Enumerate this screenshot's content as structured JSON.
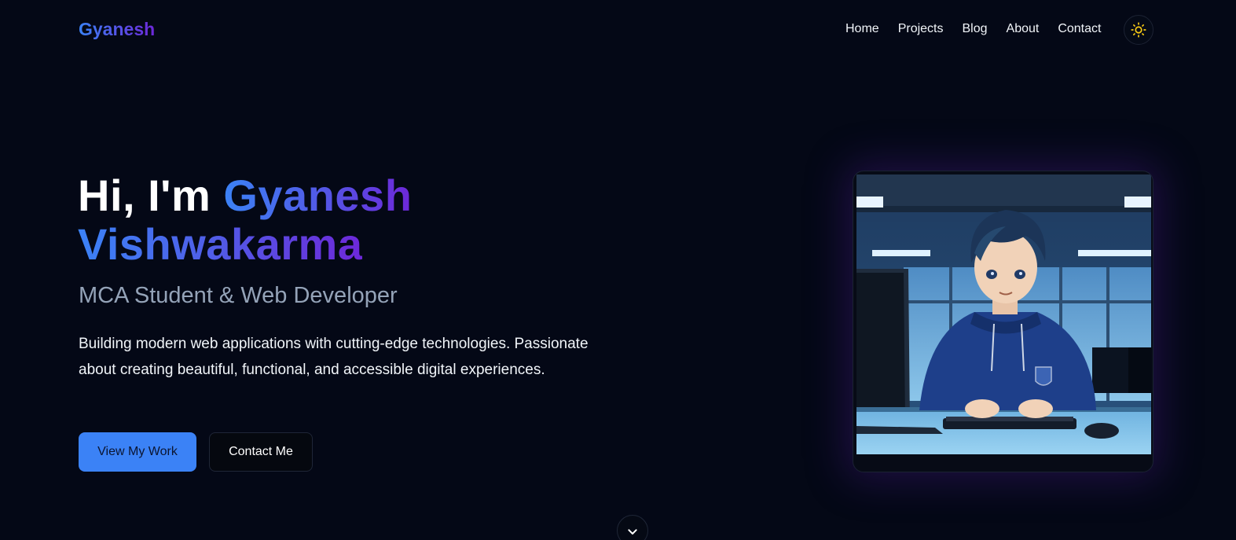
{
  "nav": {
    "logo": "Gyanesh",
    "links": [
      "Home",
      "Projects",
      "Blog",
      "About",
      "Contact"
    ],
    "theme_toggle_icon": "sun-icon"
  },
  "hero": {
    "greeting": "Hi, I'm ",
    "name_first": "Gyanesh",
    "name_last": "Vishwakarma",
    "subtitle": "MCA Student & Web Developer",
    "description": "Building modern web applications with cutting-edge technologies. Passionate about creating beautiful, functional, and accessible digital experiences.",
    "primary_button": "View My Work",
    "secondary_button": "Contact Me",
    "scroll_icon": "chevron-down-icon"
  },
  "colors": {
    "background": "#040816",
    "accent_blue": "#3b82f6",
    "accent_purple": "#6d28d9",
    "sun_icon": "#facc15"
  }
}
